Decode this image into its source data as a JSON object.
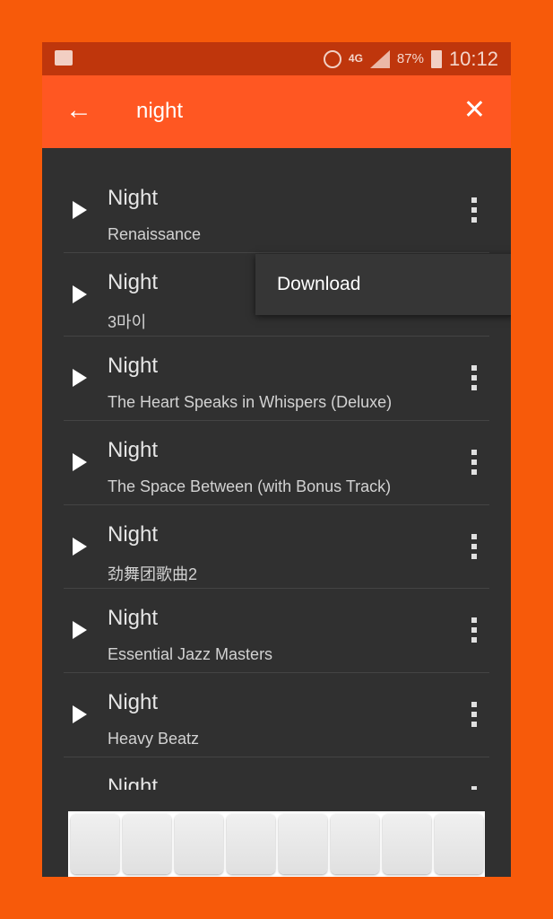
{
  "status_bar": {
    "time": "10:12",
    "battery": "87%",
    "network": "4G",
    "icons": [
      "shopping-bag-icon",
      "alarm-icon",
      "signal-icon",
      "battery-icon"
    ]
  },
  "app_bar": {
    "query": "night",
    "back_icon": "arrow-left-icon",
    "clear_icon": "close-icon"
  },
  "results": [
    {
      "title": "Night",
      "album": "Renaissance"
    },
    {
      "title": "Night",
      "album": "3마이"
    },
    {
      "title": "Night",
      "album": "The Heart Speaks in Whispers (Deluxe)"
    },
    {
      "title": "Night",
      "album": "The Space Between (with Bonus Track)"
    },
    {
      "title": "Night",
      "album": "劲舞团歌曲2"
    },
    {
      "title": "Night",
      "album": "Essential Jazz Masters"
    },
    {
      "title": "Night",
      "album": "Heavy Beatz"
    },
    {
      "title": "Night",
      "album": ""
    }
  ],
  "popup_menu": {
    "items": [
      "Download"
    ]
  },
  "colors": {
    "accent": "#ff5722",
    "status": "#bf360c",
    "background": "#303030"
  }
}
